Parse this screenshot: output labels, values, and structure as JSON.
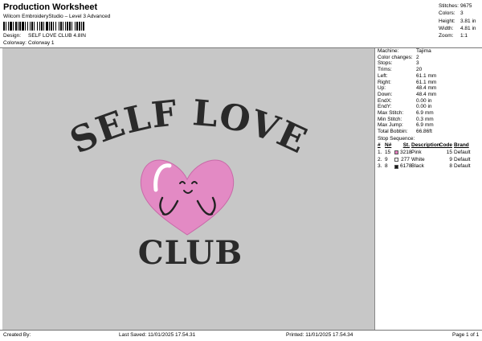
{
  "header": {
    "title": "Production Worksheet",
    "subtitle": "Wilcom EmbroideryStudio – Level 3 Advanced",
    "design_label": "Design:",
    "design_value": "SELF LOVE CLUB 4.8IN",
    "colorway_label": "Colorway:",
    "colorway_value": "Colorway 1"
  },
  "top_stats": [
    {
      "label": "Stitches:",
      "value": "9675"
    },
    {
      "label": "Colors:",
      "value": "3"
    },
    {
      "label": "Height:",
      "value": "3.81 in"
    },
    {
      "label": "Width:",
      "value": "4.81 in"
    },
    {
      "label": "Zoom:",
      "value": "1:1"
    }
  ],
  "machine_info": [
    {
      "label": "Machine:",
      "value": "Tajima"
    },
    {
      "label": "Color changes:",
      "value": "2"
    },
    {
      "label": "Stops:",
      "value": "3"
    },
    {
      "label": "Trims:",
      "value": "20"
    },
    {
      "label": "Left:",
      "value": "61.1 mm"
    },
    {
      "label": "Right:",
      "value": "61.1 mm"
    },
    {
      "label": "Up:",
      "value": "48.4 mm"
    },
    {
      "label": "Down:",
      "value": "48.4 mm"
    },
    {
      "label": "EndX:",
      "value": "0.00 in"
    },
    {
      "label": "EndY:",
      "value": "0.00 in"
    },
    {
      "label": "Max Stitch:",
      "value": "6.9 mm"
    },
    {
      "label": "Min Stitch:",
      "value": "0.3 mm"
    },
    {
      "label": "Max Jump:",
      "value": "6.9 mm"
    },
    {
      "label": "Total Bobbin:",
      "value": "66.86ft"
    }
  ],
  "stop_sequence": {
    "title": "Stop Sequence:",
    "headers": {
      "idx": "#",
      "n": "N#",
      "st": "St.",
      "desc": "Description",
      "code": "Code",
      "brand": "Brand"
    },
    "rows": [
      {
        "idx": "1.",
        "n": "15",
        "color": "#e77fc0",
        "st": "3218",
        "desc": "Pink",
        "code": "15",
        "brand": "Default"
      },
      {
        "idx": "2.",
        "n": "9",
        "color": "#ffffff",
        "st": "277",
        "desc": "White",
        "code": "9",
        "brand": "Default"
      },
      {
        "idx": "3.",
        "n": "8",
        "color": "#1a1a1a",
        "st": "6178",
        "desc": "Black",
        "code": "8",
        "brand": "Default"
      }
    ]
  },
  "design_preview": {
    "top_text": "SELF LOVE",
    "bottom_text": "CLUB",
    "background": "#c7c7c7",
    "heart_color": "#e38ac4",
    "text_color": "#2a2a2a"
  },
  "footer": {
    "created_by": "Created By:",
    "last_saved": "Last Saved: 11/01/2025 17.54.31",
    "printed": "Printed: 11/01/2025 17.54.34",
    "page": "Page 1 of 1"
  }
}
